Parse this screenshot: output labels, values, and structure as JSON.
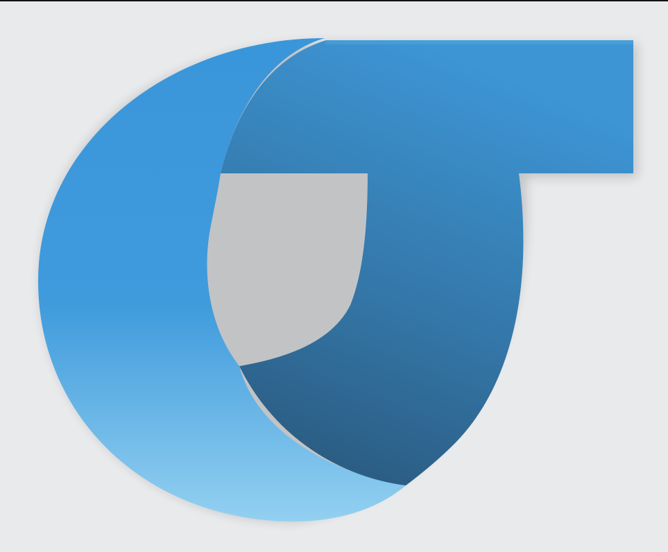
{
  "logo": {
    "name": "blue-ribbon-logo-mark",
    "colors": {
      "background": "#e9eaec",
      "blue_light": "#8fcdf0",
      "blue_mid": "#3f97d6",
      "blue_dark": "#2c5f86"
    }
  }
}
